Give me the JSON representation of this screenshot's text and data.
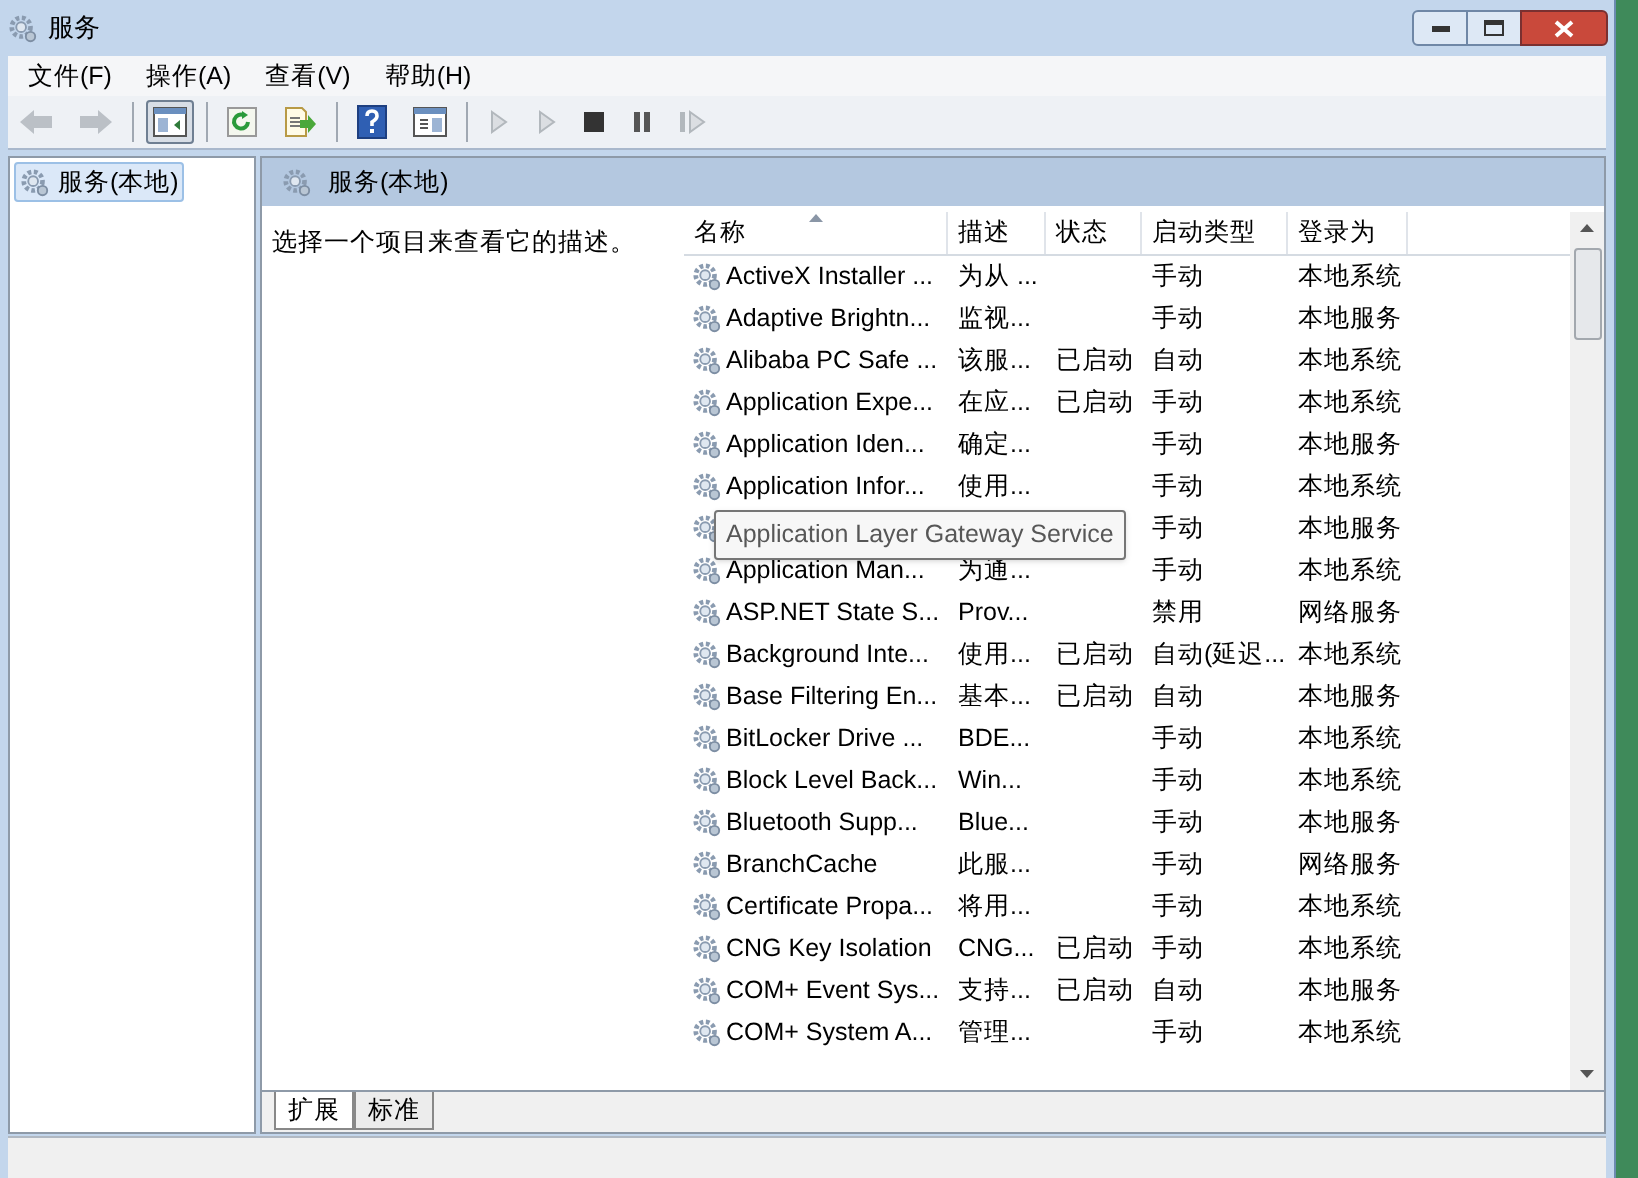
{
  "window": {
    "title": "服务"
  },
  "menu": [
    "文件(F)",
    "操作(A)",
    "查看(V)",
    "帮助(H)"
  ],
  "toolbar": [
    {
      "kind": "back",
      "disabled": true,
      "pressed": false
    },
    {
      "kind": "forward",
      "disabled": true,
      "pressed": false
    },
    {
      "kind": "separator"
    },
    {
      "kind": "tree",
      "disabled": false,
      "pressed": true
    },
    {
      "kind": "separator"
    },
    {
      "kind": "refresh",
      "disabled": false,
      "pressed": false
    },
    {
      "kind": "export",
      "disabled": false,
      "pressed": false
    },
    {
      "kind": "separator"
    },
    {
      "kind": "help",
      "disabled": false,
      "pressed": false
    },
    {
      "kind": "view",
      "disabled": false,
      "pressed": false
    },
    {
      "kind": "separator"
    },
    {
      "kind": "start",
      "disabled": true,
      "pressed": false
    },
    {
      "kind": "start",
      "disabled": true,
      "pressed": false
    },
    {
      "kind": "stop",
      "disabled": false,
      "pressed": false
    },
    {
      "kind": "pause",
      "disabled": false,
      "pressed": false
    },
    {
      "kind": "resume",
      "disabled": true,
      "pressed": false
    }
  ],
  "tree": {
    "items": [
      {
        "label": "服务(本地)",
        "selected": true
      }
    ]
  },
  "panel": {
    "title": "服务(本地)",
    "description": "选择一个项目来查看它的描述。"
  },
  "table": {
    "columns": [
      {
        "label": "名称",
        "sorted": true
      },
      {
        "label": "描述",
        "sorted": false
      },
      {
        "label": "状态",
        "sorted": false
      },
      {
        "label": "启动类型",
        "sorted": false
      },
      {
        "label": "登录为",
        "sorted": false
      }
    ],
    "rows": [
      {
        "name": "ActiveX Installer ...",
        "description": "为从 ...",
        "startup": "手动",
        "logon": "本地系统"
      },
      {
        "name": "Adaptive Brightn...",
        "description": "监视...",
        "startup": "手动",
        "logon": "本地服务"
      },
      {
        "name": "Alibaba PC Safe ...",
        "description": "该服...",
        "status": "已启动",
        "startup": "自动",
        "logon": "本地系统"
      },
      {
        "name": "Application Expe...",
        "description": "在应...",
        "status": "已启动",
        "startup": "手动",
        "logon": "本地系统"
      },
      {
        "name": "Application Iden...",
        "description": "确定...",
        "startup": "手动",
        "logon": "本地服务"
      },
      {
        "name": "Application Infor...",
        "description": "使用...",
        "startup": "手动",
        "logon": "本地系统"
      },
      {
        "tooltip": "Application Layer Gateway Service",
        "startup": "手动",
        "logon": "本地服务"
      },
      {
        "name": "Application Man...",
        "description": "为通...",
        "startup": "手动",
        "logon": "本地系统"
      },
      {
        "name": "ASP.NET State S...",
        "description": "Prov...",
        "startup": "禁用",
        "logon": "网络服务"
      },
      {
        "name": "Background Inte...",
        "description": "使用...",
        "status": "已启动",
        "startup": "自动(延迟...",
        "logon": "本地系统"
      },
      {
        "name": "Base Filtering En...",
        "description": "基本...",
        "status": "已启动",
        "startup": "自动",
        "logon": "本地服务"
      },
      {
        "name": "BitLocker Drive ...",
        "description": "BDE...",
        "startup": "手动",
        "logon": "本地系统"
      },
      {
        "name": "Block Level Back...",
        "description": "Win...",
        "startup": "手动",
        "logon": "本地系统"
      },
      {
        "name": "Bluetooth Supp...",
        "description": "Blue...",
        "startup": "手动",
        "logon": "本地服务"
      },
      {
        "name": "BranchCache",
        "description": "此服...",
        "startup": "手动",
        "logon": "网络服务"
      },
      {
        "name": "Certificate Propa...",
        "description": "将用...",
        "startup": "手动",
        "logon": "本地系统"
      },
      {
        "name": "CNG Key Isolation",
        "description": "CNG...",
        "status": "已启动",
        "startup": "手动",
        "logon": "本地系统"
      },
      {
        "name": "COM+ Event Sys...",
        "description": "支持...",
        "status": "已启动",
        "startup": "自动",
        "logon": "本地服务"
      },
      {
        "name": "COM+ System A...",
        "description": "管理...",
        "startup": "手动",
        "logon": "本地系统"
      }
    ]
  },
  "bottom_tabs": [
    {
      "label": "扩展",
      "selected": true
    },
    {
      "label": "标准",
      "selected": false
    }
  ]
}
